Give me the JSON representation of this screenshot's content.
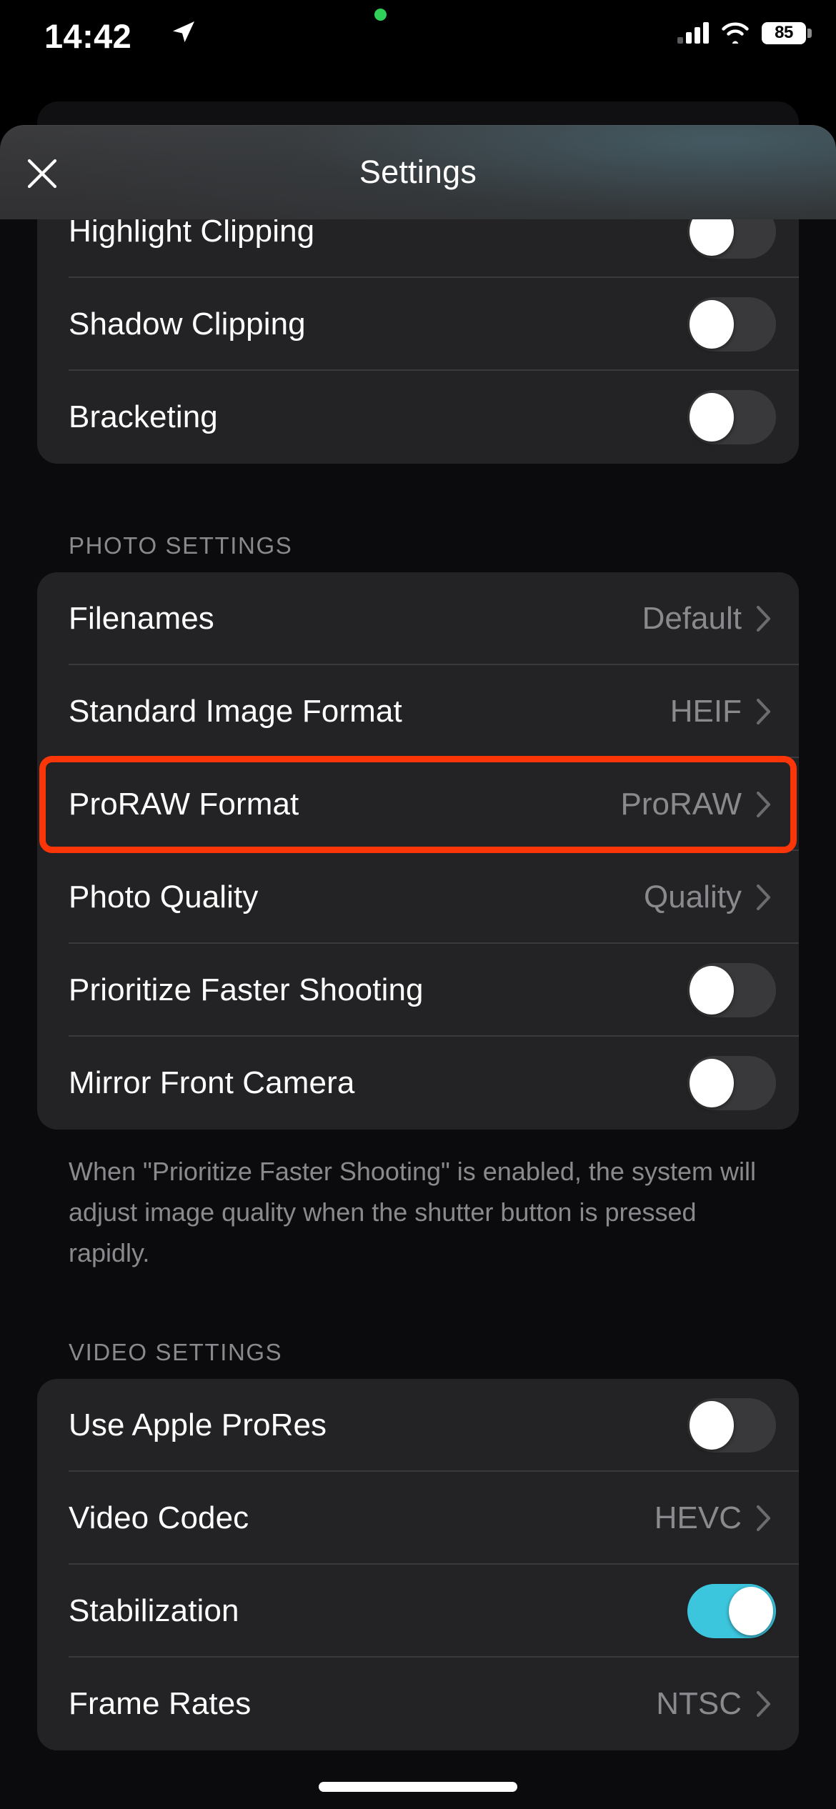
{
  "status_bar": {
    "time": "14:42",
    "location_icon": "location-arrow-icon",
    "recording_icon": "green-recording-dot",
    "cellular_icon": "cellular-signal-icon",
    "cellular_bars_filled": 3,
    "wifi_icon": "wifi-icon",
    "battery_percent": "85",
    "battery_icon": "battery-icon"
  },
  "header": {
    "title": "Settings",
    "close_icon": "close-x-icon"
  },
  "groups": [
    {
      "id": "image-analysis-group",
      "header": null,
      "clipped_top": true,
      "rows": [
        {
          "label": "Highlight Clipping",
          "type": "toggle",
          "on": false
        },
        {
          "label": "Shadow Clipping",
          "type": "toggle",
          "on": false
        },
        {
          "label": "Bracketing",
          "type": "toggle",
          "on": false
        }
      ],
      "footnote": null
    },
    {
      "id": "photo-settings-group",
      "header": "PHOTO SETTINGS",
      "clipped_top": false,
      "rows": [
        {
          "label": "Filenames",
          "type": "value",
          "value": "Default"
        },
        {
          "label": "Standard Image Format",
          "type": "value",
          "value": "HEIF"
        },
        {
          "label": "ProRAW Format",
          "type": "value",
          "value": "ProRAW",
          "highlighted": true
        },
        {
          "label": "Photo Quality",
          "type": "value",
          "value": "Quality"
        },
        {
          "label": "Prioritize Faster Shooting",
          "type": "toggle",
          "on": false
        },
        {
          "label": "Mirror Front Camera",
          "type": "toggle",
          "on": false
        }
      ],
      "footnote": "When \"Prioritize Faster Shooting\" is enabled, the system will adjust image quality when the shutter button is pressed rapidly."
    },
    {
      "id": "video-settings-group",
      "header": "VIDEO SETTINGS",
      "clipped_top": false,
      "rows": [
        {
          "label": "Use Apple ProRes",
          "type": "toggle",
          "on": false
        },
        {
          "label": "Video Codec",
          "type": "value",
          "value": "HEVC"
        },
        {
          "label": "Stabilization",
          "type": "toggle",
          "on": true
        },
        {
          "label": "Frame Rates",
          "type": "value",
          "value": "NTSC"
        }
      ],
      "footnote": null
    }
  ],
  "annotation": {
    "target_row_label": "ProRAW Format",
    "box_color": "#fa3508"
  },
  "colors": {
    "page_background": "#0b0b0d",
    "card_background": "#232325",
    "header_gradient_start": "#3b3b3d",
    "header_tint": "#4c7481",
    "primary_text": "#ffffff",
    "secondary_text": "#8a8a8e",
    "separator": "#3a3a3c",
    "toggle_on": "#3cc6de",
    "toggle_off": "#39393b",
    "battery_fill": "#ffffff",
    "recording_dot": "#30d158",
    "highlight_box": "#fa3508"
  },
  "home_indicator": "home-indicator-bar"
}
